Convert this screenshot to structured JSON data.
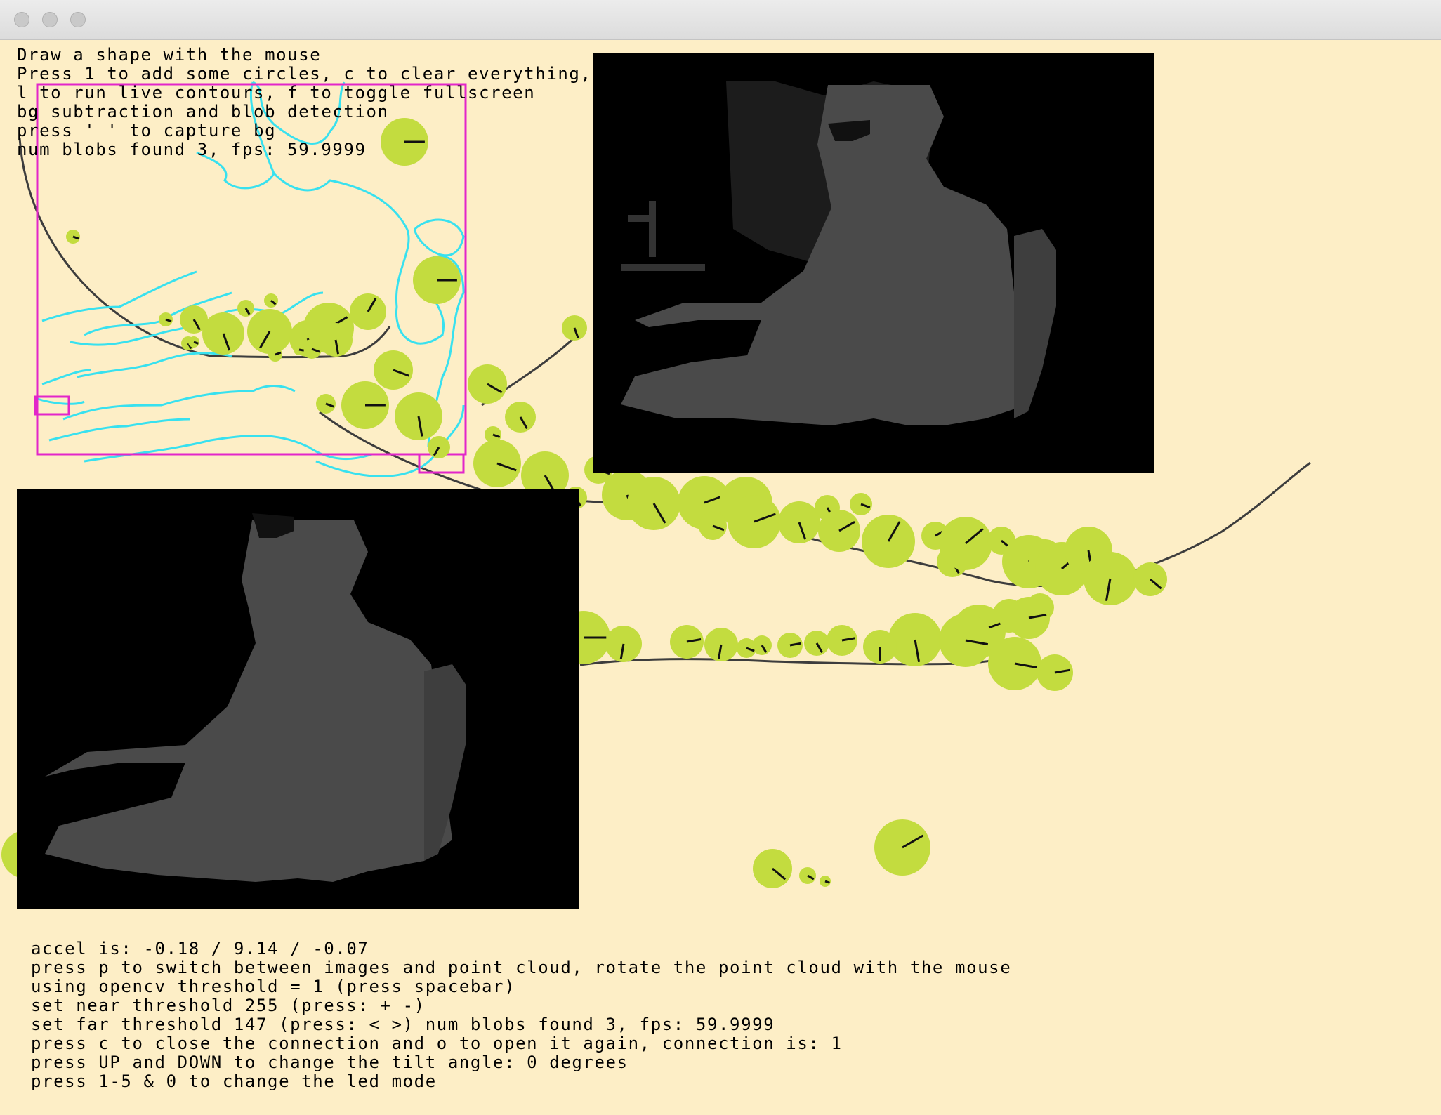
{
  "window": {
    "controls": [
      "close",
      "minimize",
      "maximize"
    ]
  },
  "hud_top": {
    "lines": [
      "Draw a shape with the mouse",
      "Press 1 to add some circles, c to clear everything,",
      "l to run live contours, f to toggle fullscreen",
      "bg subtraction and blob detection",
      "press ' ' to capture bg",
      "num blobs found 3, fps: 59.9999"
    ]
  },
  "hud_bottom": {
    "lines": [
      "accel is: -0.18 / 9.14 / -0.07",
      "press p to switch between images and point cloud, rotate the point cloud with the mouse",
      "using opencv threshold = 1 (press spacebar)",
      "set near threshold 255 (press: + -)",
      "set far threshold 147 (press: < >) num blobs found 3, fps: 59.9999",
      "press c to close the connection and o to open it again, connection is: 1",
      "press UP and DOWN to change the tilt angle: 0 degrees",
      "press 1-5 & 0 to change the led mode"
    ]
  },
  "colors": {
    "background": "#fdeec6",
    "circle": "#c3dc3f",
    "contour": "#38e1ef",
    "bounding_box": "#e226c9",
    "drawn_path": "#3d3d3d",
    "depth_person": "#4a4a4a",
    "depth_bg": "#000000"
  },
  "images": {
    "depth_top": "kinect-depth-image",
    "depth_bottom": "kinect-depth-image-thresholded"
  }
}
